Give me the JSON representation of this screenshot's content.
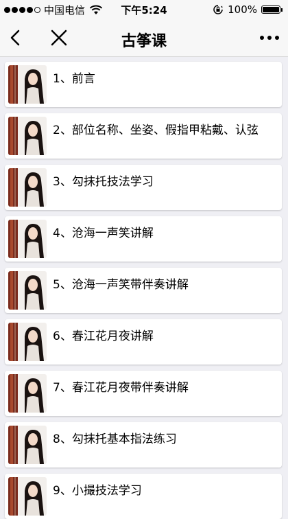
{
  "status_bar": {
    "carrier": "中国电信",
    "time": "下午5:24",
    "battery": "100%",
    "icons": [
      "signal-dots-icon",
      "wifi-icon",
      "orientation-lock-icon",
      "battery-icon"
    ]
  },
  "nav": {
    "title": "古筝课",
    "icons": [
      "back-chevron-icon",
      "close-icon",
      "more-icon"
    ]
  },
  "lessons": [
    {
      "title": "1、前言"
    },
    {
      "title": "2、部位名称、坐姿、假指甲粘戴、认弦"
    },
    {
      "title": "3、勾抹托技法学习"
    },
    {
      "title": "4、沧海一声笑讲解"
    },
    {
      "title": "5、沧海一声笑带伴奏讲解"
    },
    {
      "title": "6、春江花月夜讲解"
    },
    {
      "title": "7、春江花月夜带伴奏讲解"
    },
    {
      "title": "8、勾抹托基本指法练习"
    },
    {
      "title": "9、小撮技法学习"
    }
  ],
  "colors": {
    "background": "#efeff4",
    "bar": "#f7f7f7",
    "card": "#ffffff",
    "thumb_wood": "#7a2c1e",
    "thumb_hair": "#1a1210"
  }
}
